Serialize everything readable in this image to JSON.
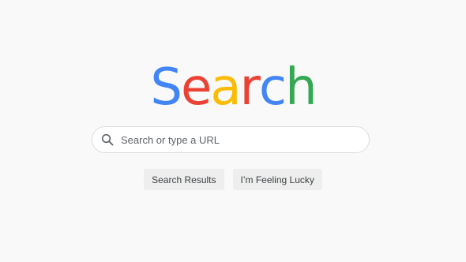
{
  "logo": {
    "letters": [
      {
        "char": "S",
        "color": "#4285F4"
      },
      {
        "char": "e",
        "color": "#EA4335"
      },
      {
        "char": "a",
        "color": "#FBBC05"
      },
      {
        "char": "r",
        "color": "#EA4335"
      },
      {
        "char": "c",
        "color": "#4285F4"
      },
      {
        "char": "h",
        "color": "#34A853"
      }
    ]
  },
  "search": {
    "placeholder": "Search or type a URL",
    "value": "",
    "icon": "search-icon"
  },
  "buttons": {
    "search_results": "Search Results",
    "feeling_lucky": "I’m Feeling Lucky"
  }
}
